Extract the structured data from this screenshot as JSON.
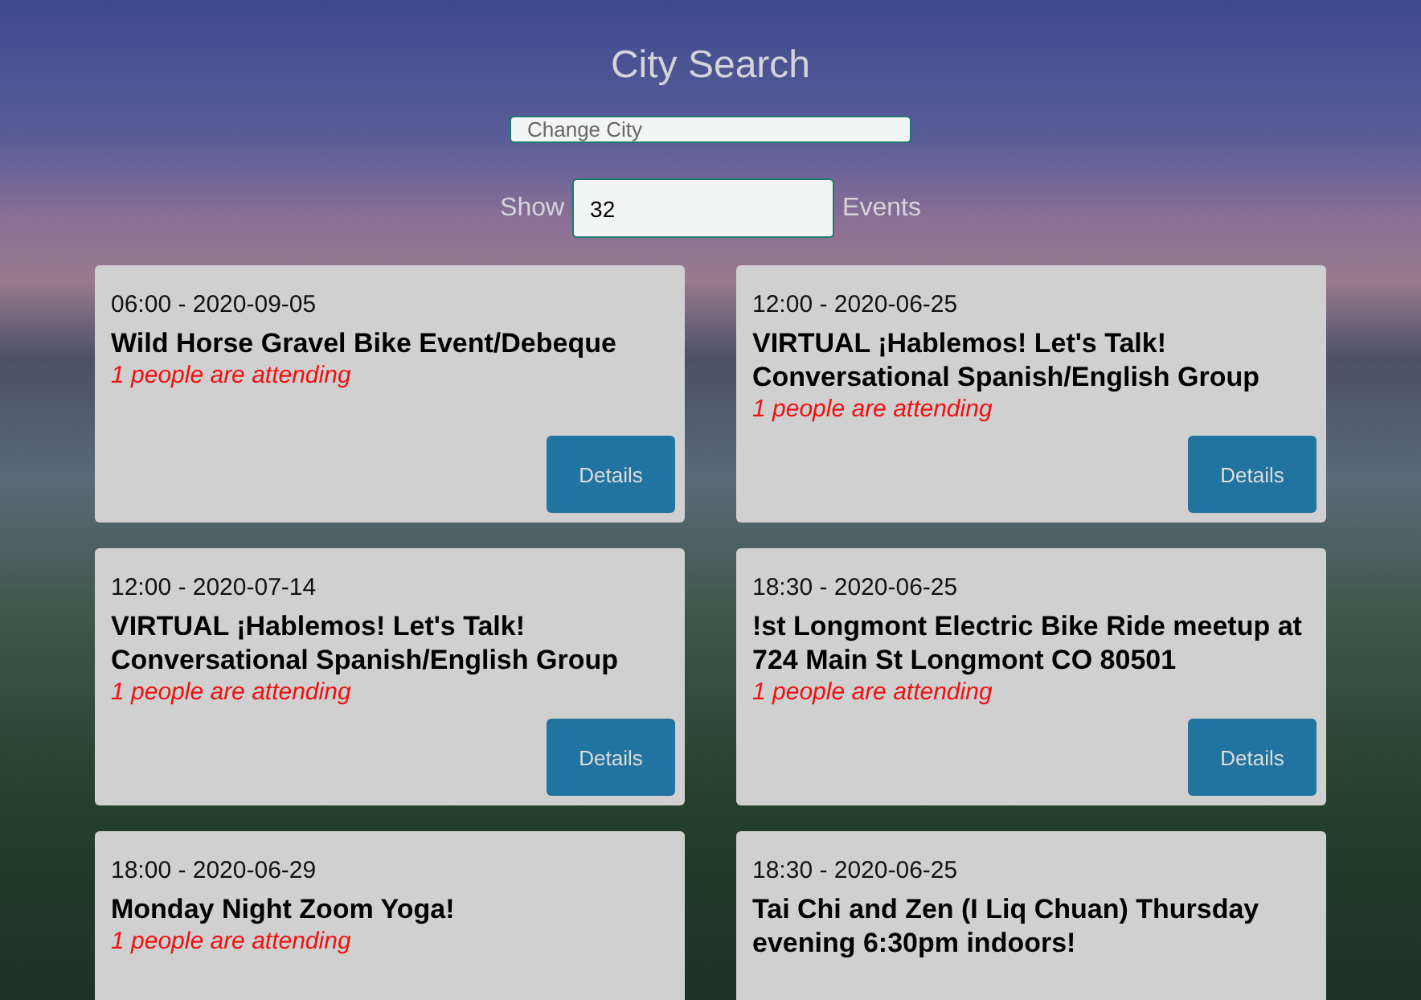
{
  "title": "City Search",
  "city_field": {
    "placeholder": "Change City"
  },
  "show_events": {
    "label_before": "Show",
    "value": "32",
    "label_after": "Events"
  },
  "events": [
    {
      "time": "06:00 - 2020-09-05",
      "name": "Wild Horse Gravel Bike Event/Debeque",
      "attending": "1 people are attending",
      "button": "Details"
    },
    {
      "time": "12:00 - 2020-06-25",
      "name": "VIRTUAL ¡Hablemos! Let's Talk! Conversational Spanish/English Group",
      "attending": "1 people are attending",
      "button": "Details"
    },
    {
      "time": "12:00 - 2020-07-14",
      "name": "VIRTUAL ¡Hablemos! Let's Talk! Conversational Spanish/English Group",
      "attending": "1 people are attending",
      "button": "Details"
    },
    {
      "time": "18:30 - 2020-06-25",
      "name": "!st Longmont Electric Bike Ride meetup at 724 Main St Longmont CO 80501",
      "attending": "1 people are attending",
      "button": "Details"
    },
    {
      "time": "18:00 - 2020-06-29",
      "name": "Monday Night Zoom Yoga!",
      "attending": "1 people are attending"
    },
    {
      "time": "18:30 - 2020-06-25",
      "name": "Tai Chi and Zen (I Liq Chuan) Thursday evening 6:30pm indoors!"
    }
  ]
}
